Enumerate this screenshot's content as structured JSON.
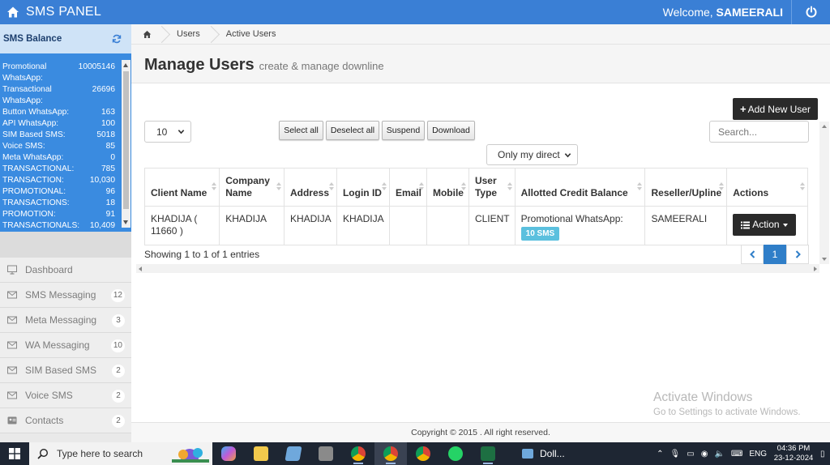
{
  "topbar": {
    "brand": "SMS PANEL",
    "welcome_prefix": "Welcome,",
    "username": "SAMEERALI"
  },
  "sidebar": {
    "balance_title": "SMS Balance",
    "balances": [
      {
        "label": "Promotional",
        "value": "10005146"
      },
      {
        "label": "WhatsApp:",
        "value": ""
      },
      {
        "label": "Transactional",
        "value": "26696"
      },
      {
        "label": "WhatsApp:",
        "value": ""
      },
      {
        "label": "Button WhatsApp:",
        "value": "163"
      },
      {
        "label": "API WhatsApp:",
        "value": "100"
      },
      {
        "label": "SIM Based SMS:",
        "value": "5018"
      },
      {
        "label": "Voice SMS:",
        "value": "85"
      },
      {
        "label": "Meta WhatsApp:",
        "value": "0"
      },
      {
        "label": "TRANSACTIONAL:",
        "value": "785"
      },
      {
        "label": "TRANSACTION:",
        "value": "10,030"
      },
      {
        "label": "PROMOTIONAL:",
        "value": "96"
      },
      {
        "label": "TRANSACTIONS:",
        "value": "18"
      },
      {
        "label": "PROMOTION:",
        "value": "91"
      },
      {
        "label": "TRANSACTIONALS:",
        "value": "10,409"
      }
    ],
    "nav": [
      {
        "label": "Dashboard",
        "badge": "",
        "icon": "monitor-icon"
      },
      {
        "label": "SMS Messaging",
        "badge": "12",
        "icon": "envelope-icon"
      },
      {
        "label": "Meta Messaging",
        "badge": "3",
        "icon": "envelope-icon"
      },
      {
        "label": "WA Messaging",
        "badge": "10",
        "icon": "envelope-icon"
      },
      {
        "label": "SIM Based SMS",
        "badge": "2",
        "icon": "envelope-icon"
      },
      {
        "label": "Voice SMS",
        "badge": "2",
        "icon": "envelope-icon"
      },
      {
        "label": "Contacts",
        "badge": "2",
        "icon": "contact-card-icon"
      }
    ]
  },
  "breadcrumb": {
    "items": [
      "Users",
      "Active Users"
    ]
  },
  "page": {
    "title": "Manage Users",
    "subtitle": "create & manage downline"
  },
  "toolbar": {
    "add_label": "Add New User",
    "page_length": "10",
    "select_all": "Select all",
    "deselect_all": "Deselect all",
    "suspend": "Suspend",
    "download": "Download",
    "search_placeholder": "Search...",
    "filter_value": "Only my direct"
  },
  "table": {
    "headers": [
      {
        "l1": "",
        "l2": "Client Name"
      },
      {
        "l1": "Company",
        "l2": "Name"
      },
      {
        "l1": "",
        "l2": "Address"
      },
      {
        "l1": "",
        "l2": "Login ID"
      },
      {
        "l1": "",
        "l2": "Email"
      },
      {
        "l1": "",
        "l2": "Mobile"
      },
      {
        "l1": "User",
        "l2": "Type"
      },
      {
        "l1": "",
        "l2": "Allotted Credit Balance"
      },
      {
        "l1": "",
        "l2": "Reseller/Upline"
      },
      {
        "l1": "",
        "l2": "Actions"
      }
    ],
    "rows": [
      {
        "client_name_1": "KHADIJA (",
        "client_name_2": "11660 )",
        "company": "KHADIJA",
        "address": "KHADIJA",
        "login_id": "KHADIJA",
        "email": "",
        "mobile": "",
        "user_type": "CLIENT",
        "credit_label": "Promotional WhatsApp:",
        "credit_badge": "10 SMS",
        "reseller": "SAMEERALI",
        "action_label": "Action"
      }
    ],
    "info": "Showing 1 to 1 of 1 entries",
    "current_page": "1"
  },
  "watermark": {
    "line1": "Activate Windows",
    "line2": "Go to Settings to activate Windows."
  },
  "footer": {
    "text": "Copyright © 2015 . All right reserved."
  },
  "taskbar": {
    "search_placeholder": "Type here to search",
    "weather": "Doll...",
    "language": "ENG",
    "time": "04:36 PM",
    "date": "23-12-2024"
  },
  "colors": {
    "topbar": "#3a7fd5",
    "balance_panel": "#3a8be0",
    "primary_button": "#2a2a2a",
    "badge_info": "#5bc0de",
    "page_active": "#2f7ec8"
  }
}
